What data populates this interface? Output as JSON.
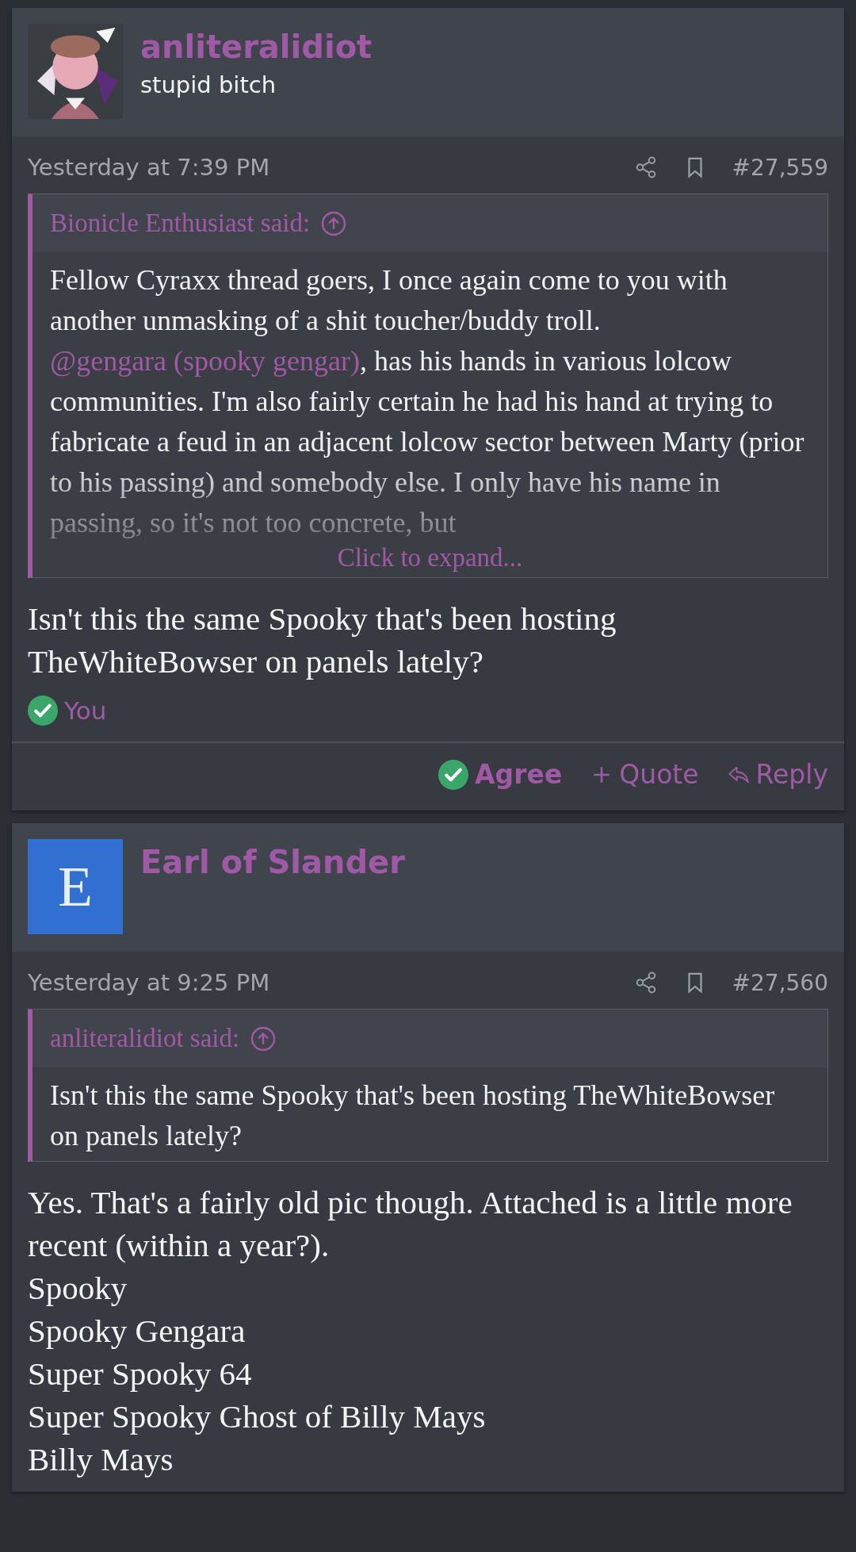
{
  "posts": [
    {
      "author": {
        "name": "anliteralidiot",
        "title": "stupid bitch"
      },
      "time": "Yesterday at 7:39 PM",
      "number": "#27,559",
      "quote": {
        "attribution": "Bionicle Enthusiast said:",
        "expand_label": "Click to expand...",
        "segments": [
          {
            "kind": "text",
            "text": "Fellow Cyraxx thread goers, I once again come to you with another unmasking of a shit toucher/buddy troll. "
          },
          {
            "kind": "mention",
            "text": "@gengara (spooky gengar)"
          },
          {
            "kind": "text",
            "text": ", has his hands in various lolcow communities. I'm also fairly certain he had his hand at trying to fabricate a feud in an adjacent lolcow sector between Marty (prior to his passing) and somebody else. I only have his name in passing, so it's not too concrete, but"
          }
        ]
      },
      "lines": [
        "Isn't this the same Spooky that's been hosting TheWhiteBowser on panels lately?"
      ],
      "reaction": {
        "label": "You"
      },
      "actions": [
        {
          "kind": "agree",
          "label": "Agree",
          "selected": true
        },
        {
          "kind": "quote",
          "label": "Quote",
          "selected": false
        },
        {
          "kind": "reply",
          "label": "Reply",
          "selected": false
        }
      ]
    },
    {
      "author": {
        "name": "Earl of Slander",
        "avatar": {
          "kind": "letter",
          "letter": "E",
          "color": "#3170d0"
        }
      },
      "time": "Yesterday at 9:25 PM",
      "number": "#27,560",
      "quote": {
        "attribution": "anliteralidiot said:",
        "segments": [
          {
            "kind": "text",
            "text": "Isn't this the same Spooky that's been hosting TheWhiteBowser on panels lately?"
          }
        ]
      },
      "lines": [
        "Yes. That's a fairly old pic though. Attached is a little more recent (within a year?).",
        "Spooky",
        "Spooky Gengara",
        "Super Spooky 64",
        "Super Spooky Ghost of Billy Mays",
        "Billy Mays"
      ]
    }
  ]
}
